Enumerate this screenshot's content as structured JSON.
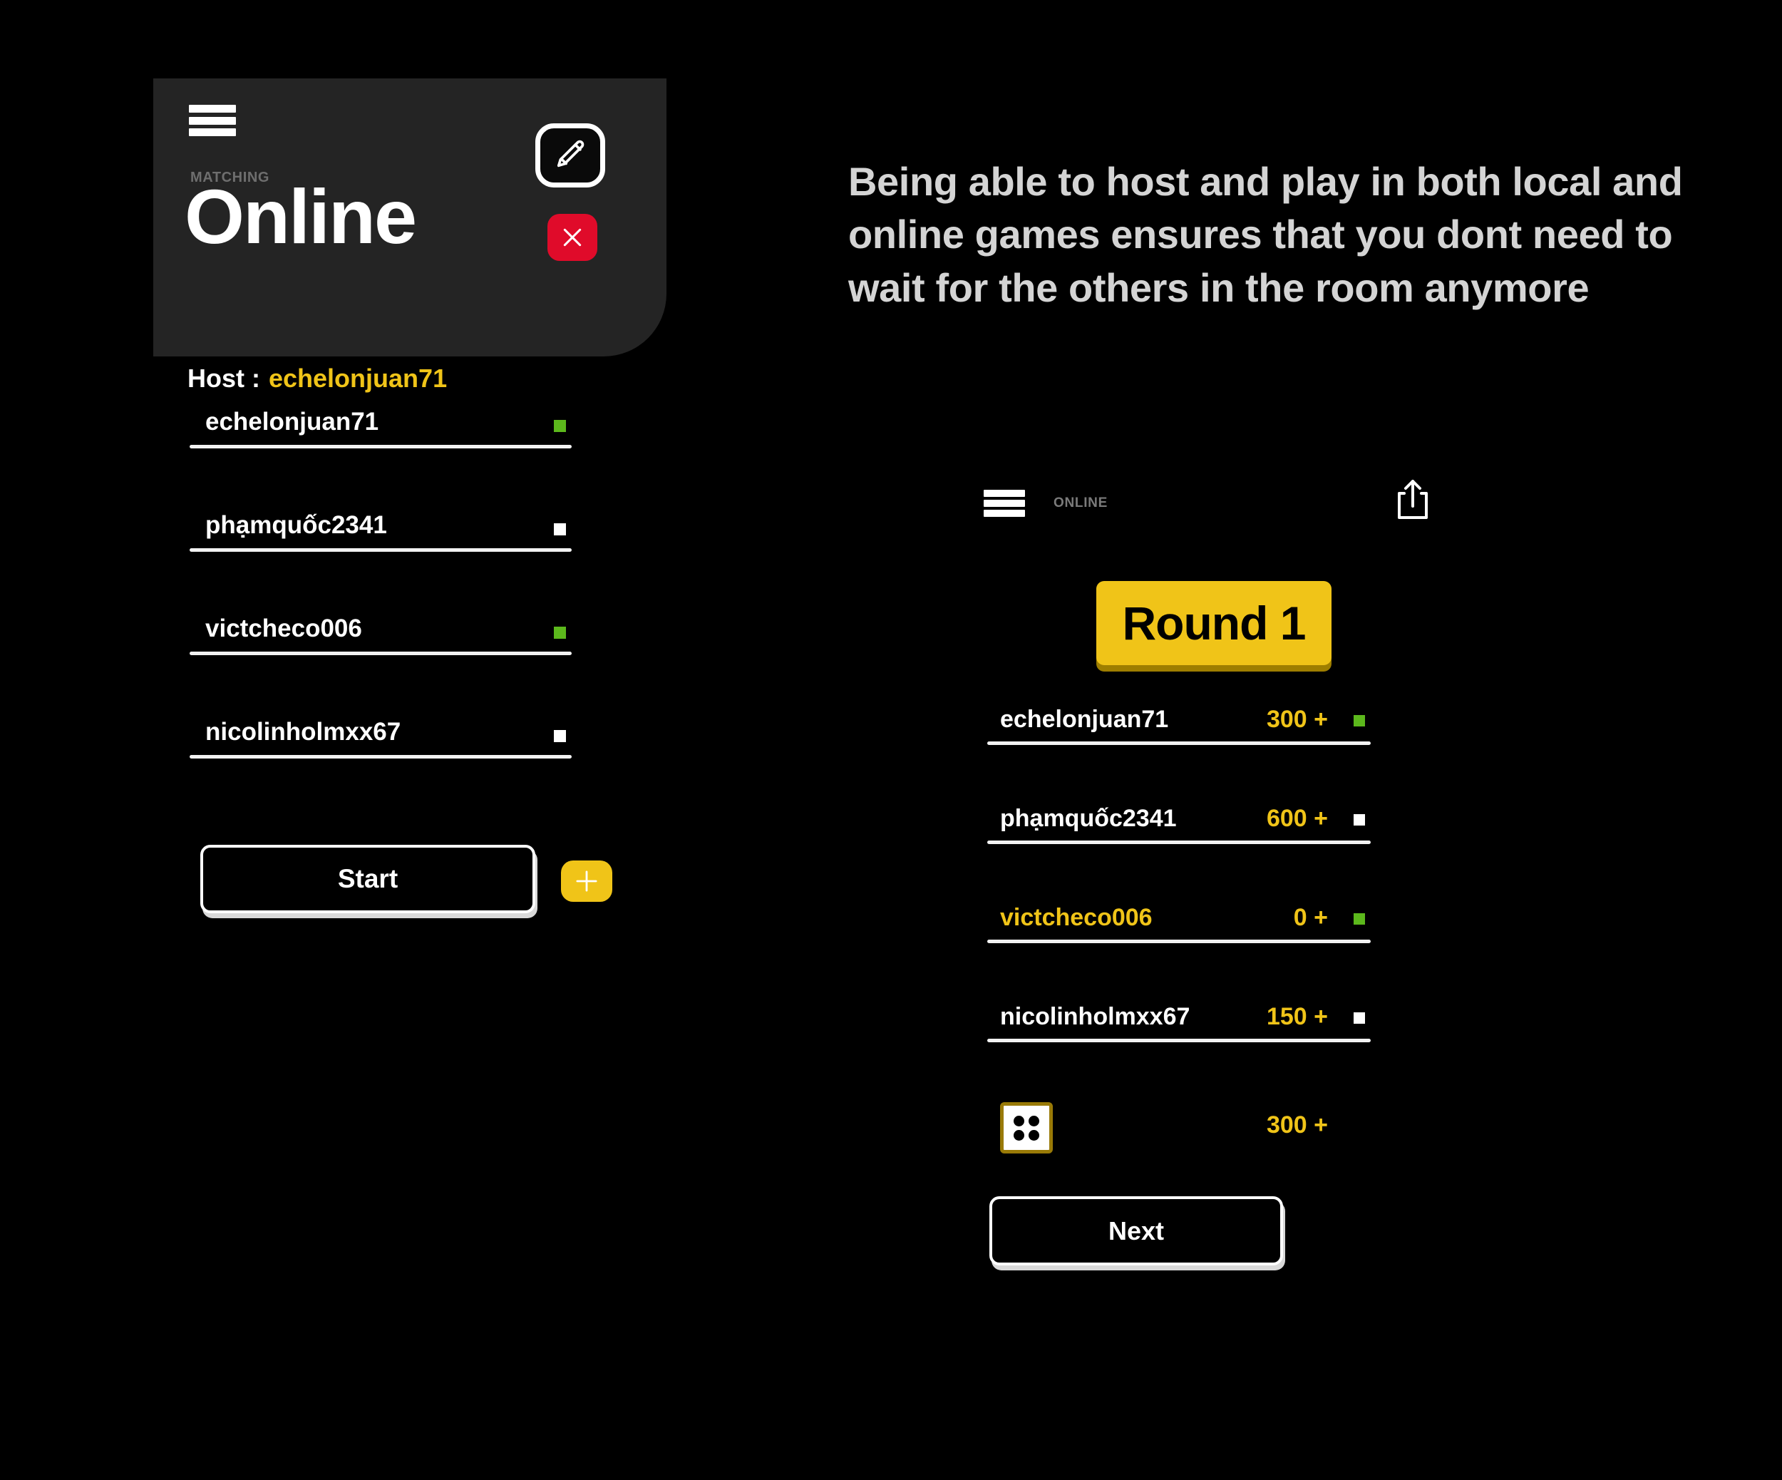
{
  "colors": {
    "background": "#000000",
    "card_surface": "#242424",
    "accent_gold": "#F0C418",
    "danger_red": "#E00B2A",
    "online_green": "#5CB81C",
    "offline_white": "#FFFFFF",
    "rule_white": "#F2F2F2",
    "headline_gray": "#D4D4D4",
    "eyebrow_gray": "#6E6E6E",
    "die_border_gold": "#997A07",
    "banner_shadow": "#9E7E00"
  },
  "lobby": {
    "menu_icon": "hamburger-menu-icon",
    "eyebrow": "MATCHING",
    "title": "Online",
    "host_label": "Host :",
    "host_name": "echelonjuan71",
    "edit_icon": "pencil-edit-icon",
    "close_icon": "close-x-icon",
    "players": [
      {
        "name": "echelonjuan71",
        "status": "online",
        "status_color": "#5CB81C"
      },
      {
        "name": "phạmquốc2341",
        "status": "offline",
        "status_color": "#FFFFFF"
      },
      {
        "name": "victcheco006",
        "status": "online",
        "status_color": "#5CB81C"
      },
      {
        "name": "nicolinholmxx67",
        "status": "offline",
        "status_color": "#FFFFFF"
      }
    ],
    "start_label": "Start",
    "add_icon": "plus-icon"
  },
  "headline": {
    "text": "Being able to host and play in both local and online games ensures that you dont need to wait for the others in the room anymore"
  },
  "game": {
    "menu_icon": "hamburger-menu-icon",
    "mode_label": "ONLINE",
    "share_icon": "share-upload-icon",
    "round_label": "Round 1",
    "scores": [
      {
        "name": "echelonjuan71",
        "value": "300 +",
        "status": "online",
        "status_color": "#5CB81C",
        "highlighted": false
      },
      {
        "name": "phạmquốc2341",
        "value": "600 +",
        "status": "offline",
        "status_color": "#FFFFFF",
        "highlighted": false
      },
      {
        "name": "victcheco006",
        "value": "0 +",
        "status": "online",
        "status_color": "#5CB81C",
        "highlighted": true
      },
      {
        "name": "nicolinholmxx67",
        "value": "150 +",
        "status": "offline",
        "status_color": "#FFFFFF",
        "highlighted": false
      }
    ],
    "dice": {
      "icon": "dice-four-icon",
      "pips": 4,
      "value": "300 +"
    },
    "next_label": "Next"
  }
}
